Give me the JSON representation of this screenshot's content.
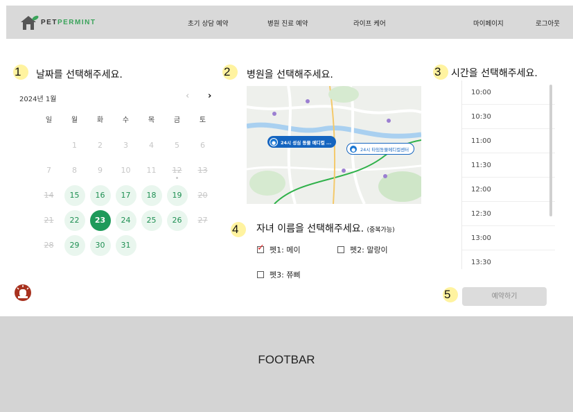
{
  "header": {
    "logo_text_prefix": "PET",
    "logo_text_suffix": "PERMINT",
    "nav": [
      "초기 상담 예약",
      "병원 진료 예약",
      "라이프 케어",
      "마이페이지",
      "로그아웃"
    ]
  },
  "steps": {
    "date": {
      "number": "1",
      "title": "날짜를 선택해주세요."
    },
    "hospital": {
      "number": "2",
      "title": "병원을 선택해주세요."
    },
    "time": {
      "number": "3",
      "title": "시간을 선택해주세요."
    },
    "pet": {
      "number": "4",
      "title": "자녀 이름을 선택해주세요.",
      "note": "(중복가능)"
    },
    "reserve": {
      "number": "5"
    }
  },
  "calendar": {
    "month_label": "2024년 1월",
    "prev_icon": "chevron-left-icon",
    "next_icon": "chevron-right-icon",
    "weekdays": [
      "일",
      "월",
      "화",
      "수",
      "목",
      "금",
      "토"
    ],
    "days": [
      {
        "d": "",
        "s": "empty"
      },
      {
        "d": "1",
        "s": "disabled"
      },
      {
        "d": "2",
        "s": "disabled"
      },
      {
        "d": "3",
        "s": "disabled"
      },
      {
        "d": "4",
        "s": "disabled"
      },
      {
        "d": "5",
        "s": "disabled"
      },
      {
        "d": "6",
        "s": "disabled"
      },
      {
        "d": "7",
        "s": "disabled"
      },
      {
        "d": "8",
        "s": "disabled"
      },
      {
        "d": "9",
        "s": "disabled"
      },
      {
        "d": "10",
        "s": "disabled"
      },
      {
        "d": "11",
        "s": "disabled"
      },
      {
        "d": "12",
        "s": "struck-dot"
      },
      {
        "d": "13",
        "s": "struck"
      },
      {
        "d": "14",
        "s": "struck"
      },
      {
        "d": "15",
        "s": "available"
      },
      {
        "d": "16",
        "s": "available"
      },
      {
        "d": "17",
        "s": "available"
      },
      {
        "d": "18",
        "s": "available"
      },
      {
        "d": "19",
        "s": "available"
      },
      {
        "d": "20",
        "s": "struck"
      },
      {
        "d": "21",
        "s": "struck"
      },
      {
        "d": "22",
        "s": "available"
      },
      {
        "d": "23",
        "s": "selected"
      },
      {
        "d": "24",
        "s": "available"
      },
      {
        "d": "25",
        "s": "available"
      },
      {
        "d": "26",
        "s": "available"
      },
      {
        "d": "27",
        "s": "struck"
      },
      {
        "d": "28",
        "s": "struck"
      },
      {
        "d": "29",
        "s": "available"
      },
      {
        "d": "30",
        "s": "available"
      },
      {
        "d": "31",
        "s": "available"
      }
    ]
  },
  "map": {
    "markers": [
      {
        "label": "24시 성심 동물 메디컬 ...",
        "style": "primary"
      },
      {
        "label": "24시 타임동물메디컬센터",
        "style": "secondary"
      }
    ]
  },
  "pets": [
    {
      "label": "펫1: 메이",
      "checked": true
    },
    {
      "label": "펫2: 말랑이",
      "checked": false
    },
    {
      "label": "펫3: 쮸삐",
      "checked": false
    }
  ],
  "times": [
    "10:00",
    "10:30",
    "11:00",
    "11:30",
    "12:00",
    "12:30",
    "13:00",
    "13:30"
  ],
  "reserve_button": "예약하기",
  "footer": {
    "label": "FOOTBAR"
  },
  "colors": {
    "accent": "#1e9a5a",
    "available_bg": "#e9f6ee",
    "map_marker": "#1565c0",
    "step_badge": "#fff3a0",
    "check": "#e02020"
  }
}
